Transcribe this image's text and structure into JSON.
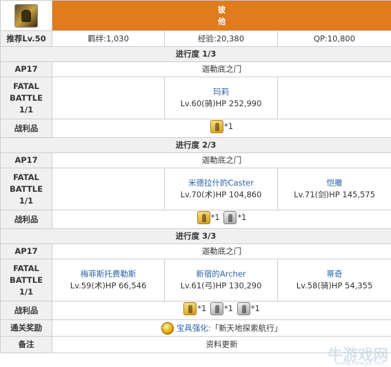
{
  "header": {
    "title_line1": "彼",
    "title_line2": "他"
  },
  "summary": {
    "recommend": "推荐Lv.50",
    "bond": "羁绊:1,030",
    "exp": "经验:20,380",
    "qp": "QP:10,800"
  },
  "labels": {
    "fatal": "FATAL\nBATTLE\n1/1",
    "loot": "战利品",
    "clear_reward": "通关奖励",
    "note": "备注"
  },
  "progress": [
    {
      "title": "进行度 1/3",
      "ap": "AP17",
      "location": "迦勒底之门",
      "enemies": [
        {
          "name": "",
          "stats": ""
        },
        {
          "name": "玛莉",
          "stats": "Lv.60(骑)HP 252,990"
        },
        {
          "name": "",
          "stats": ""
        }
      ],
      "drops": [
        {
          "type": "gold",
          "qty": "*1"
        }
      ]
    },
    {
      "title": "进行度 2/3",
      "ap": "AP17",
      "location": "迦勒底之门",
      "enemies": [
        {
          "name": "",
          "stats": ""
        },
        {
          "name": "米德拉什的Caster",
          "stats": "Lv.70(术)HP 104,860"
        },
        {
          "name": "恺撒",
          "stats": "Lv.71(剑)HP 145,575"
        }
      ],
      "drops": [
        {
          "type": "gold",
          "qty": "*1"
        },
        {
          "type": "silver",
          "qty": "*1"
        }
      ]
    },
    {
      "title": "进行度 3/3",
      "ap": "AP17",
      "location": "迦勒底之门",
      "enemies": [
        {
          "name": "梅菲斯托费勒斯",
          "stats": "Lv.59(术)HP 66,546"
        },
        {
          "name": "新宿的Archer",
          "stats": "Lv.61(弓)HP 130,290"
        },
        {
          "name": "蒂奇",
          "stats": "Lv.58(骑)HP 54,355"
        }
      ],
      "drops": [
        {
          "type": "gold",
          "qty": "*1"
        },
        {
          "type": "silver",
          "qty": "*1"
        },
        {
          "type": "silver",
          "qty": "*1"
        }
      ]
    }
  ],
  "clear_reward": {
    "prefix": "宝具强化:",
    "text": "「新天地探索航行」"
  },
  "note": "资料更新",
  "watermark": {
    "main": "牛游戏网",
    "sub": "www.newyx.net"
  },
  "colors": {
    "header_bg": "#e07b1e",
    "label_bg": "#f0f0f0",
    "link": "#2a62a8",
    "border": "#cccccc"
  }
}
